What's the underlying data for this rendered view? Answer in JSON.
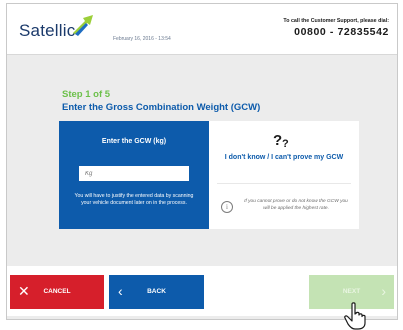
{
  "header": {
    "logo": "Satellic",
    "date": "February 16, 2016 - 13:54",
    "support_label": "To call the Customer Support, please dial:",
    "support_phone": "00800 - 72835542"
  },
  "step": {
    "indicator": "Step 1 of 5",
    "title": "Enter the Gross Combination Weight (GCW)"
  },
  "left_card": {
    "heading": "Enter the GCW (kg)",
    "input_placeholder": "Kg",
    "input_value": "",
    "note": "You will have to justify the entered data by scanning your vehicle document later on in the process."
  },
  "right_card": {
    "option_label": "I don't know / I can't prove my GCW",
    "info_text": "If you cannot prove or do not know the GCW you will be applied the highest rate."
  },
  "buttons": {
    "cancel": "CANCEL",
    "back": "BACK",
    "next": "NEXT"
  },
  "colors": {
    "brand_blue": "#0d5bab",
    "step_green": "#6cc04a",
    "cancel_red": "#d61f2b",
    "next_disabled": "#c4e3b4"
  },
  "icons": {
    "logo_mark": "satellite-arrow-icon",
    "question": "question-mark-icon",
    "info": "info-icon",
    "cancel": "close-icon",
    "back": "chevron-left-icon",
    "next": "chevron-right-icon",
    "cursor": "hand-pointer-icon"
  }
}
